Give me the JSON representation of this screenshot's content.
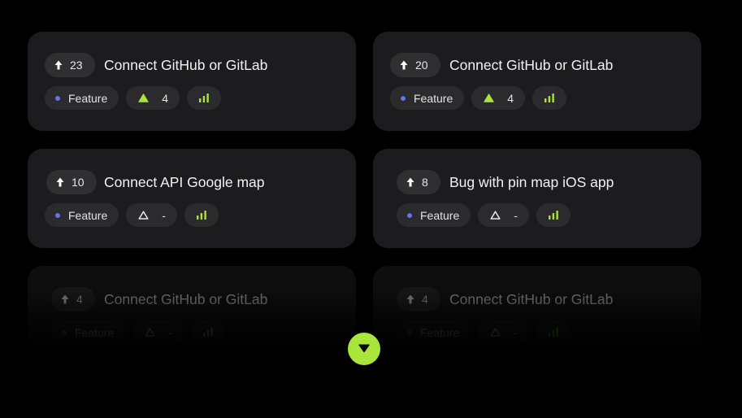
{
  "cards": [
    {
      "votes": "23",
      "title": "Connect GitHub or GitLab",
      "type": "Feature",
      "priority": "4",
      "priority_level": "high"
    },
    {
      "votes": "20",
      "title": "Connect GitHub or GitLab",
      "type": "Feature",
      "priority": "4",
      "priority_level": "high"
    },
    {
      "votes": "10",
      "title": "Connect API Google map",
      "type": "Feature",
      "priority": "-",
      "priority_level": "none"
    },
    {
      "votes": "8",
      "title": "Bug with pin map iOS app",
      "type": "Feature",
      "priority": "-",
      "priority_level": "none"
    },
    {
      "votes": "4",
      "title": "Connect GitHub or GitLab",
      "type": "Feature",
      "priority": "-",
      "priority_level": "none"
    },
    {
      "votes": "4",
      "title": "Connect GitHub or GitLab",
      "type": "Feature",
      "priority": "-",
      "priority_level": "none"
    }
  ],
  "icons": {
    "vote": "arrow-up-icon",
    "type": "dot-icon",
    "priority": "triangle-icon",
    "signal": "signal-bars-icon",
    "expand": "caret-down-icon"
  },
  "colors": {
    "background": "#000000",
    "card": "#1c1c1e",
    "pill": "#2b2b2d",
    "accent": "#a9e53a",
    "type_dot": "#6275e8"
  }
}
